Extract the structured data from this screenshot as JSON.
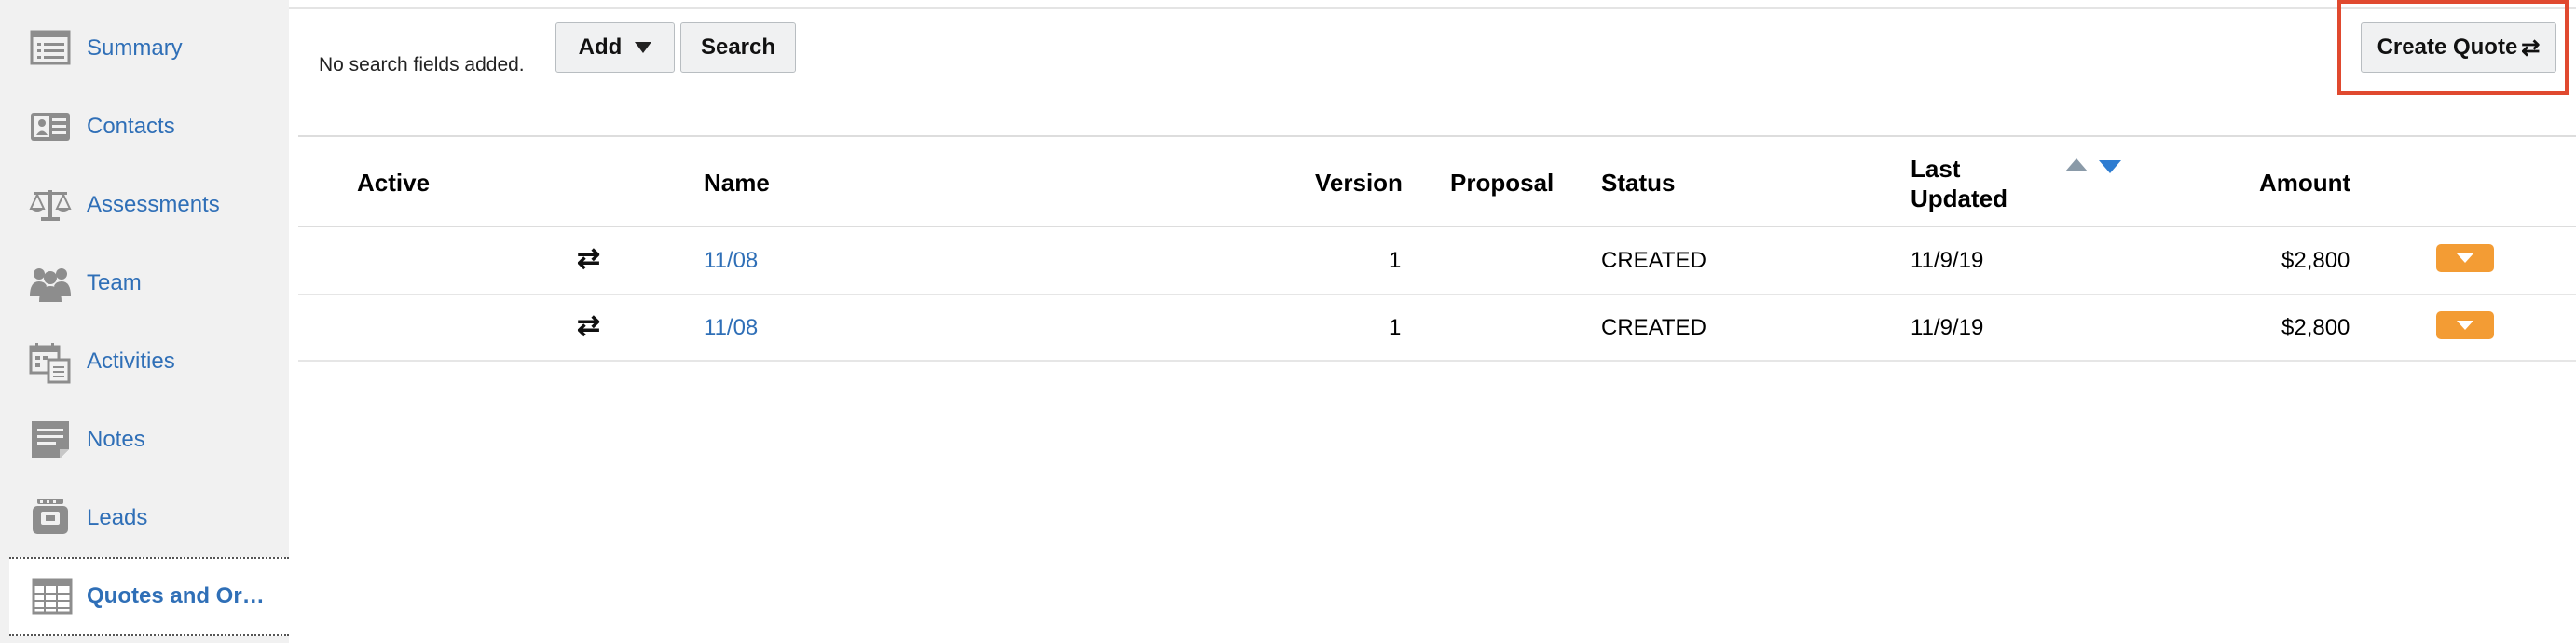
{
  "sidebar": {
    "items": [
      {
        "label": "Summary",
        "icon": "summary-list-icon"
      },
      {
        "label": "Contacts",
        "icon": "contact-card-icon"
      },
      {
        "label": "Assessments",
        "icon": "scales-icon"
      },
      {
        "label": "Team",
        "icon": "team-people-icon"
      },
      {
        "label": "Activities",
        "icon": "calendar-activities-icon"
      },
      {
        "label": "Notes",
        "icon": "note-icon"
      },
      {
        "label": "Leads",
        "icon": "leads-tray-icon"
      },
      {
        "label": "Quotes and Or…",
        "icon": "quotes-table-icon",
        "active": true
      }
    ]
  },
  "toolbar": {
    "no_search_text": "No search fields added.",
    "add_label": "Add",
    "search_label": "Search",
    "create_quote_label": "Create Quote",
    "create_quote_icon": "⇄"
  },
  "table": {
    "headers": {
      "active": "Active",
      "name": "Name",
      "version": "Version",
      "proposal": "Proposal",
      "status": "Status",
      "last_updated_1": "Last",
      "last_updated_2": "Updated",
      "amount": "Amount"
    },
    "rows": [
      {
        "name": "11/08",
        "version": "1",
        "proposal": "",
        "status": "CREATED",
        "last_updated": "11/9/19",
        "amount": "$2,800"
      },
      {
        "name": "11/08",
        "version": "1",
        "proposal": "",
        "status": "CREATED",
        "last_updated": "11/9/19",
        "amount": "$2,800"
      }
    ]
  },
  "colors": {
    "link": "#2f6fb7",
    "row_menu": "#f39c34",
    "highlight": "#e0492f",
    "sidebar_bg": "#f1f1f1"
  }
}
